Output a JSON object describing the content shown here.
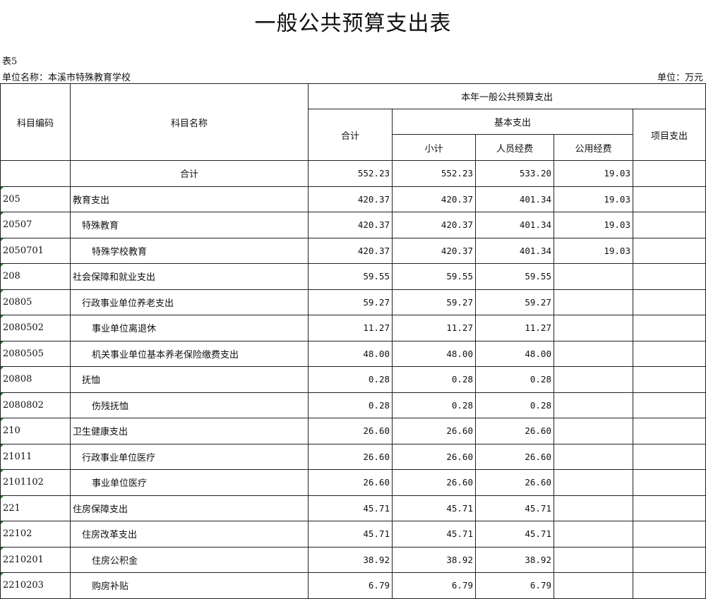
{
  "title": "一般公共预算支出表",
  "table_no": "表5",
  "unit_name": "单位名称：本溪市特殊教育学校",
  "unit": "单位：万元",
  "headers": {
    "code": "科目编码",
    "name": "科目名称",
    "group": "本年一般公共预算支出",
    "total": "合计",
    "basic": "基本支出",
    "subtotal": "小计",
    "personnel": "人员经费",
    "public": "公用经费",
    "project": "项目支出"
  },
  "rows": [
    {
      "code": "",
      "name": "合计",
      "total": "552.23",
      "subtotal": "552.23",
      "personnel": "533.20",
      "public": "19.03",
      "project": ""
    },
    {
      "code": "205",
      "name": "教育支出",
      "total": "420.37",
      "subtotal": "420.37",
      "personnel": "401.34",
      "public": "19.03",
      "project": ""
    },
    {
      "code": "20507",
      "name": "特殊教育",
      "total": "420.37",
      "subtotal": "420.37",
      "personnel": "401.34",
      "public": "19.03",
      "project": ""
    },
    {
      "code": "2050701",
      "name": "特殊学校教育",
      "total": "420.37",
      "subtotal": "420.37",
      "personnel": "401.34",
      "public": "19.03",
      "project": ""
    },
    {
      "code": "208",
      "name": "社会保障和就业支出",
      "total": "59.55",
      "subtotal": "59.55",
      "personnel": "59.55",
      "public": "",
      "project": ""
    },
    {
      "code": "20805",
      "name": "行政事业单位养老支出",
      "total": "59.27",
      "subtotal": "59.27",
      "personnel": "59.27",
      "public": "",
      "project": ""
    },
    {
      "code": "2080502",
      "name": "事业单位离退休",
      "total": "11.27",
      "subtotal": "11.27",
      "personnel": "11.27",
      "public": "",
      "project": ""
    },
    {
      "code": "2080505",
      "name": "机关事业单位基本养老保险缴费支出",
      "total": "48.00",
      "subtotal": "48.00",
      "personnel": "48.00",
      "public": "",
      "project": ""
    },
    {
      "code": "20808",
      "name": "抚恤",
      "total": "0.28",
      "subtotal": "0.28",
      "personnel": "0.28",
      "public": "",
      "project": ""
    },
    {
      "code": "2080802",
      "name": "伤残抚恤",
      "total": "0.28",
      "subtotal": "0.28",
      "personnel": "0.28",
      "public": "",
      "project": ""
    },
    {
      "code": "210",
      "name": "卫生健康支出",
      "total": "26.60",
      "subtotal": "26.60",
      "personnel": "26.60",
      "public": "",
      "project": ""
    },
    {
      "code": "21011",
      "name": "行政事业单位医疗",
      "total": "26.60",
      "subtotal": "26.60",
      "personnel": "26.60",
      "public": "",
      "project": ""
    },
    {
      "code": "2101102",
      "name": "事业单位医疗",
      "total": "26.60",
      "subtotal": "26.60",
      "personnel": "26.60",
      "public": "",
      "project": ""
    },
    {
      "code": "221",
      "name": "住房保障支出",
      "total": "45.71",
      "subtotal": "45.71",
      "personnel": "45.71",
      "public": "",
      "project": ""
    },
    {
      "code": "22102",
      "name": "住房改革支出",
      "total": "45.71",
      "subtotal": "45.71",
      "personnel": "45.71",
      "public": "",
      "project": ""
    },
    {
      "code": "2210201",
      "name": "住房公积金",
      "total": "38.92",
      "subtotal": "38.92",
      "personnel": "38.92",
      "public": "",
      "project": ""
    },
    {
      "code": "2210203",
      "name": "购房补贴",
      "total": "6.79",
      "subtotal": "6.79",
      "personnel": "6.79",
      "public": "",
      "project": ""
    }
  ]
}
